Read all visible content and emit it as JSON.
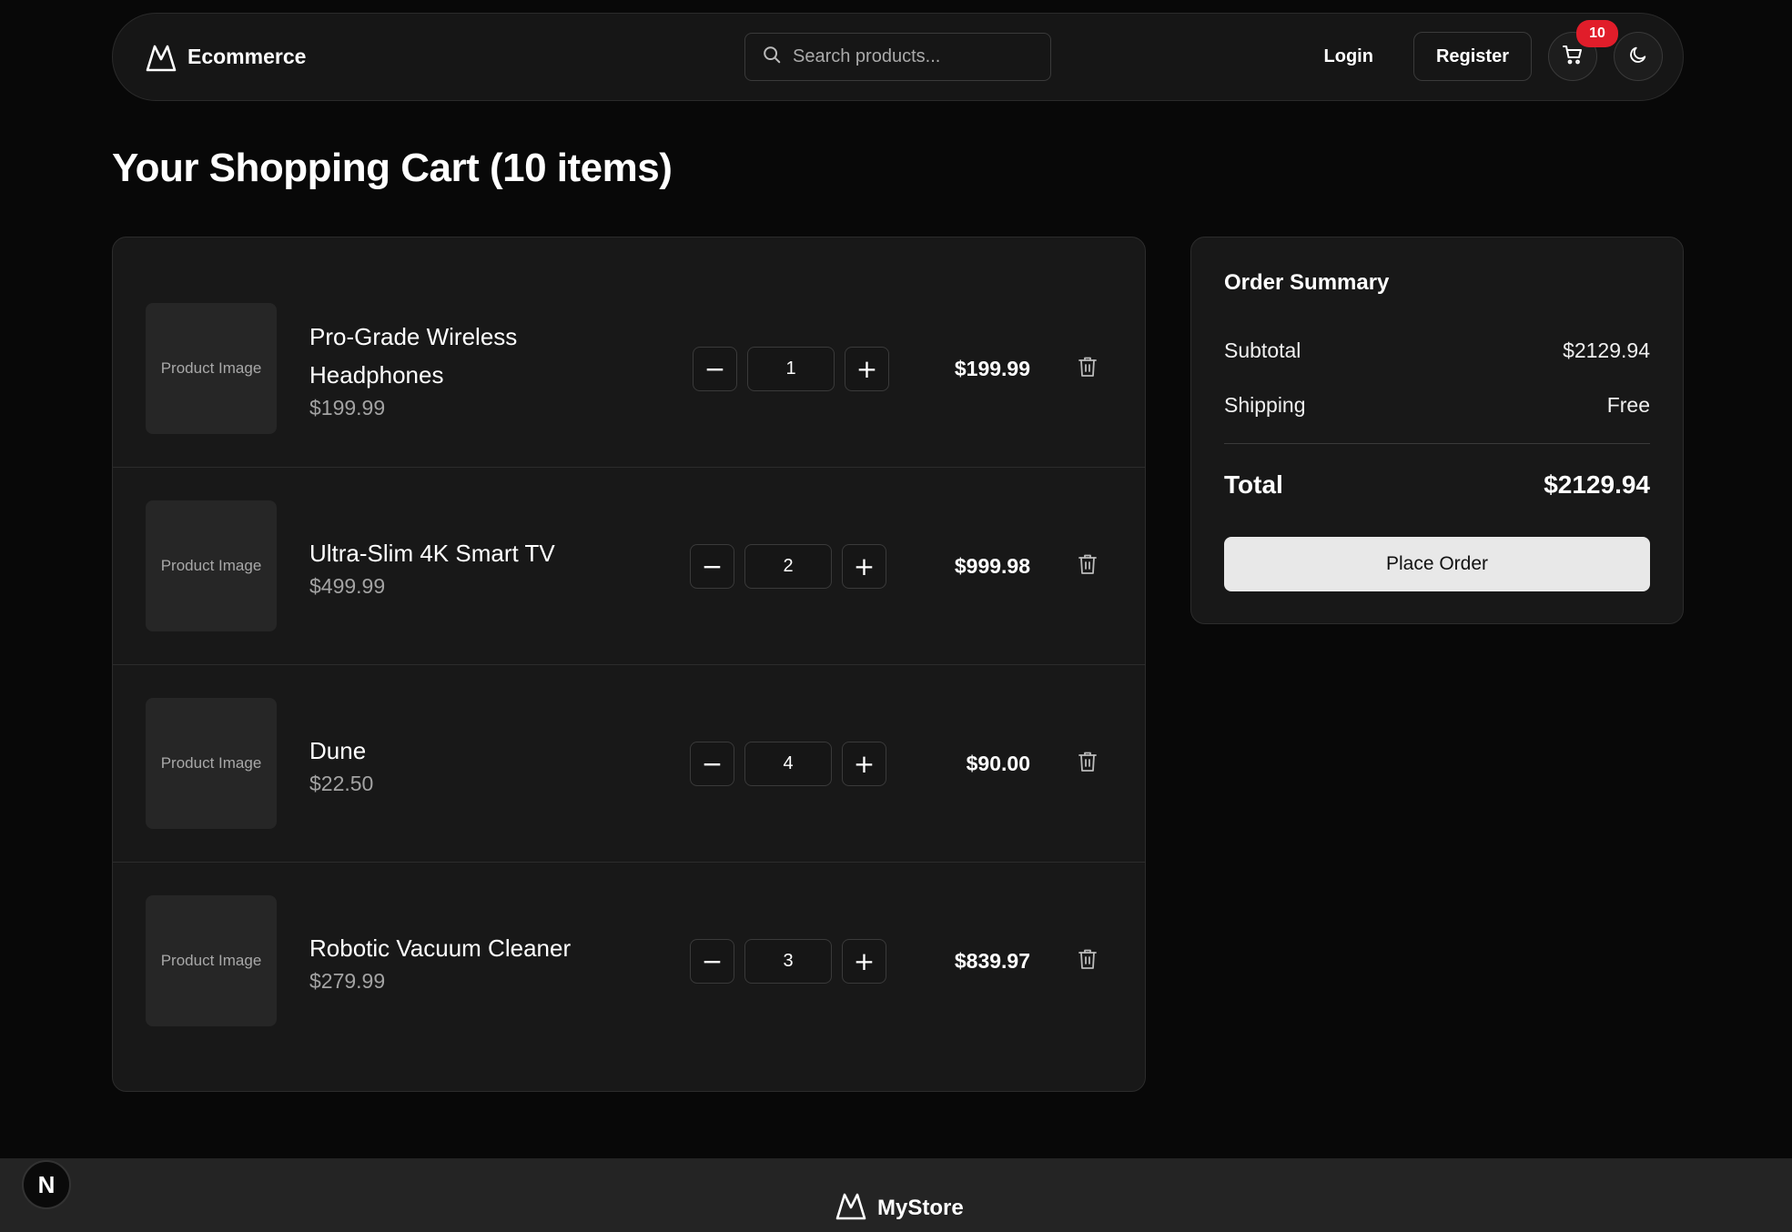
{
  "header": {
    "brand": "Ecommerce",
    "search_placeholder": "Search products...",
    "login_label": "Login",
    "register_label": "Register",
    "cart_count": "10"
  },
  "page": {
    "title": "Your Shopping Cart (10 items)"
  },
  "cart": {
    "image_placeholder": "Product Image",
    "items": [
      {
        "name": "Pro-Grade Wireless Headphones",
        "unit_price": "$199.99",
        "quantity": "1",
        "line_total": "$199.99"
      },
      {
        "name": "Ultra-Slim 4K Smart TV",
        "unit_price": "$499.99",
        "quantity": "2",
        "line_total": "$999.98"
      },
      {
        "name": "Dune",
        "unit_price": "$22.50",
        "quantity": "4",
        "line_total": "$90.00"
      },
      {
        "name": "Robotic Vacuum Cleaner",
        "unit_price": "$279.99",
        "quantity": "3",
        "line_total": "$839.97"
      }
    ],
    "decrement_symbol": "−",
    "increment_symbol": "+"
  },
  "summary": {
    "title": "Order Summary",
    "subtotal_label": "Subtotal",
    "subtotal_value": "$2129.94",
    "shipping_label": "Shipping",
    "shipping_value": "Free",
    "total_label": "Total",
    "total_value": "$2129.94",
    "place_order_label": "Place Order"
  },
  "footer": {
    "brand": "MyStore"
  },
  "dev_badge": "N",
  "icons": {
    "logo": "mountain-logo-icon",
    "search": "search-icon",
    "cart": "shopping-cart-icon",
    "theme": "moon-icon",
    "remove": "trash-icon"
  },
  "colors": {
    "background": "#080808",
    "panel": "#181818",
    "badge": "#e11d2a",
    "primary_button": "#e8e8e8"
  }
}
